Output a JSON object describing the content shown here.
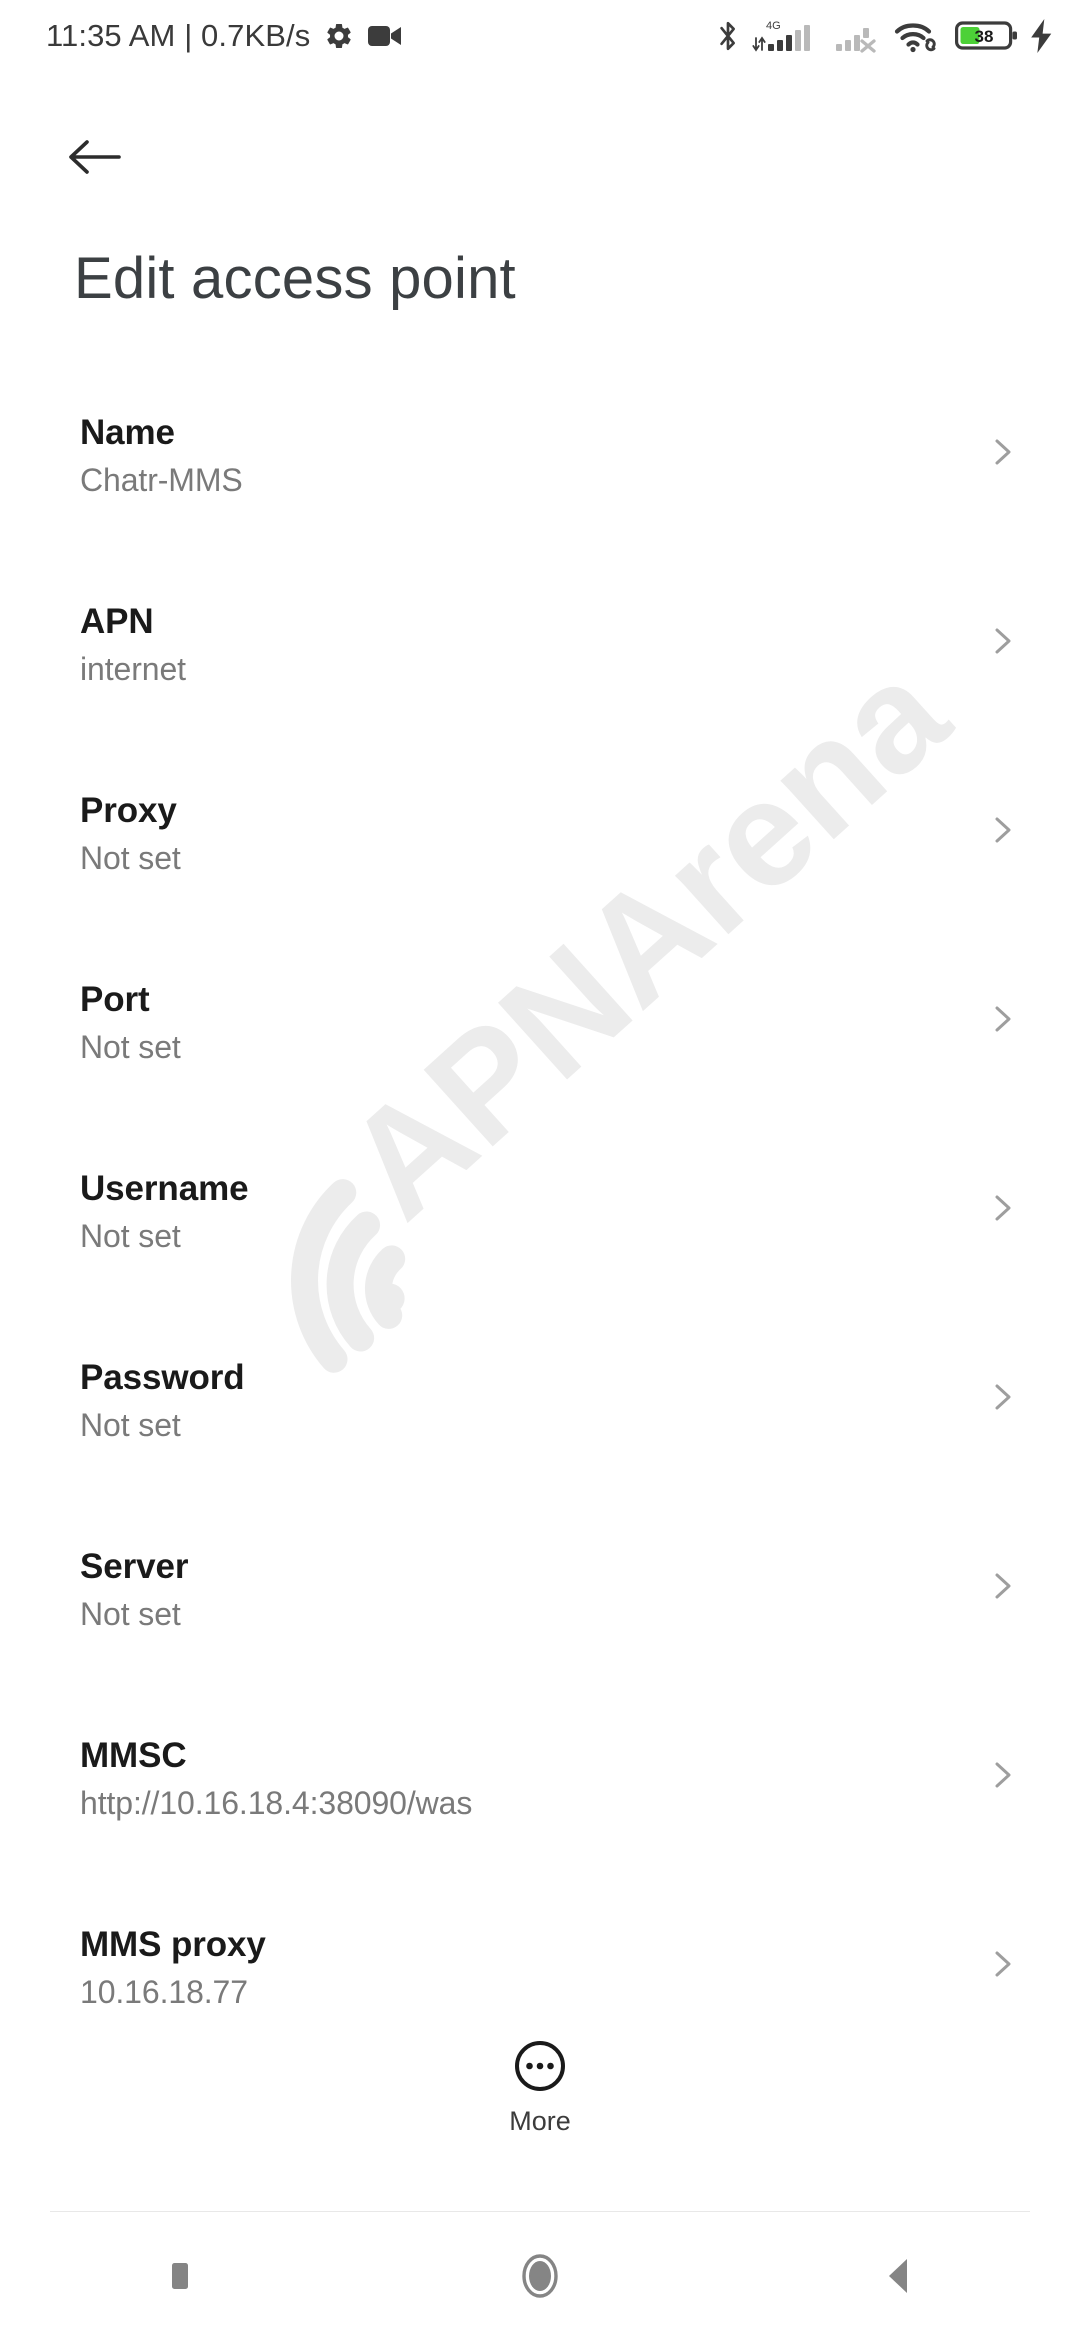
{
  "status_bar": {
    "clock": "11:35 AM | 0.7KB/s",
    "network_label": "4G",
    "battery_level": "38",
    "icons": {
      "settings": "gear-icon",
      "screen_record": "video-camera-icon",
      "bluetooth": "bluetooth-icon",
      "signal_sim1": "signal-bars-icon",
      "signal_sim2": "signal-bars-no-service-icon",
      "wifi": "wifi-link-icon",
      "battery": "battery-icon",
      "charging": "charging-bolt-icon"
    },
    "colors": {
      "text": "#3a3a3a",
      "icon": "#3c3c3c",
      "battery_fill": "#4cd137",
      "signal_inactive": "#b9b9b9"
    }
  },
  "header": {
    "back_icon": "arrow-left-icon",
    "title": "Edit access point"
  },
  "watermark": {
    "text": "APNArena",
    "icon": "wifi-arc-icon",
    "color": "#ececec"
  },
  "settings_list": [
    {
      "label": "Name",
      "value": "Chatr-MMS"
    },
    {
      "label": "APN",
      "value": "internet"
    },
    {
      "label": "Proxy",
      "value": "Not set"
    },
    {
      "label": "Port",
      "value": "Not set"
    },
    {
      "label": "Username",
      "value": "Not set"
    },
    {
      "label": "Password",
      "value": "Not set"
    },
    {
      "label": "Server",
      "value": "Not set"
    },
    {
      "label": "MMSC",
      "value": "http://10.16.18.4:38090/was"
    },
    {
      "label": "MMS proxy",
      "value": "10.16.18.77"
    }
  ],
  "more_button": {
    "label": "More",
    "icon": "more-circle-icon"
  },
  "nav_bar": {
    "recents": "square-icon",
    "home": "circle-icon",
    "back": "triangle-left-icon",
    "color": "#858585"
  }
}
